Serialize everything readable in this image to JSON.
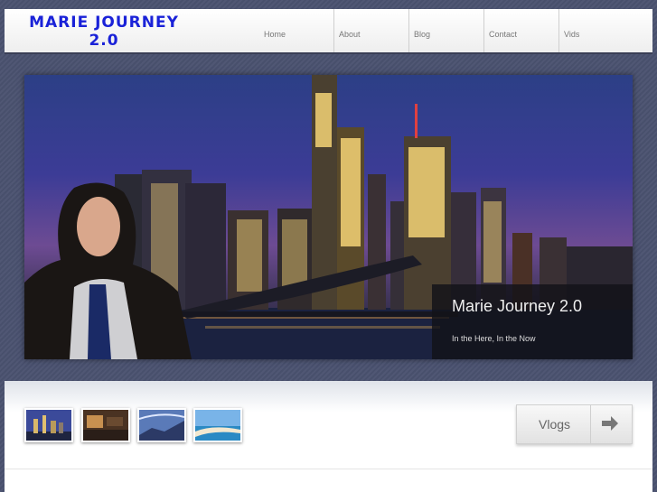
{
  "header": {
    "logo_line1": "MARIE JOURNEY",
    "logo_line2": "2.0"
  },
  "nav": {
    "items": [
      {
        "label": "Home"
      },
      {
        "label": "About"
      },
      {
        "label": "Blog"
      },
      {
        "label": "Contact"
      },
      {
        "label": "Vids"
      }
    ]
  },
  "hero": {
    "title": "Marie Journey 2.0",
    "subtitle": "In the Here, In the Now"
  },
  "vlogs_button": {
    "label": "Vlogs",
    "icon": "arrow-right-icon"
  },
  "colors": {
    "logo": "#1a22d8",
    "background": "#4a5270"
  }
}
